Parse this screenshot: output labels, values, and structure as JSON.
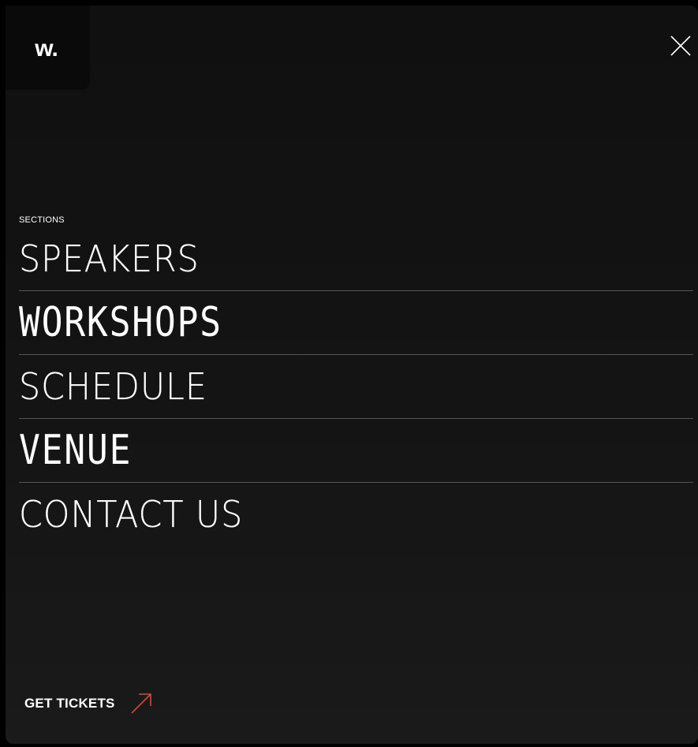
{
  "brand": {
    "logo_text": "w."
  },
  "header": {
    "close_icon": "close-icon"
  },
  "menu": {
    "sections_label": "SECTIONS",
    "items": [
      {
        "label": "SPEAKERS",
        "style": "thin"
      },
      {
        "label": "WORKSHOPS",
        "style": "pixel"
      },
      {
        "label": "SCHEDULE",
        "style": "thin"
      },
      {
        "label": "VENUE",
        "style": "pixel"
      },
      {
        "label": "CONTACT US",
        "style": "thin"
      }
    ]
  },
  "cta": {
    "label": "GET TICKETS",
    "icon": "arrow-up-right-icon"
  },
  "colors": {
    "background": "#121212",
    "text": "#ffffff",
    "divider": "#555555",
    "accent": "#e0452e"
  }
}
